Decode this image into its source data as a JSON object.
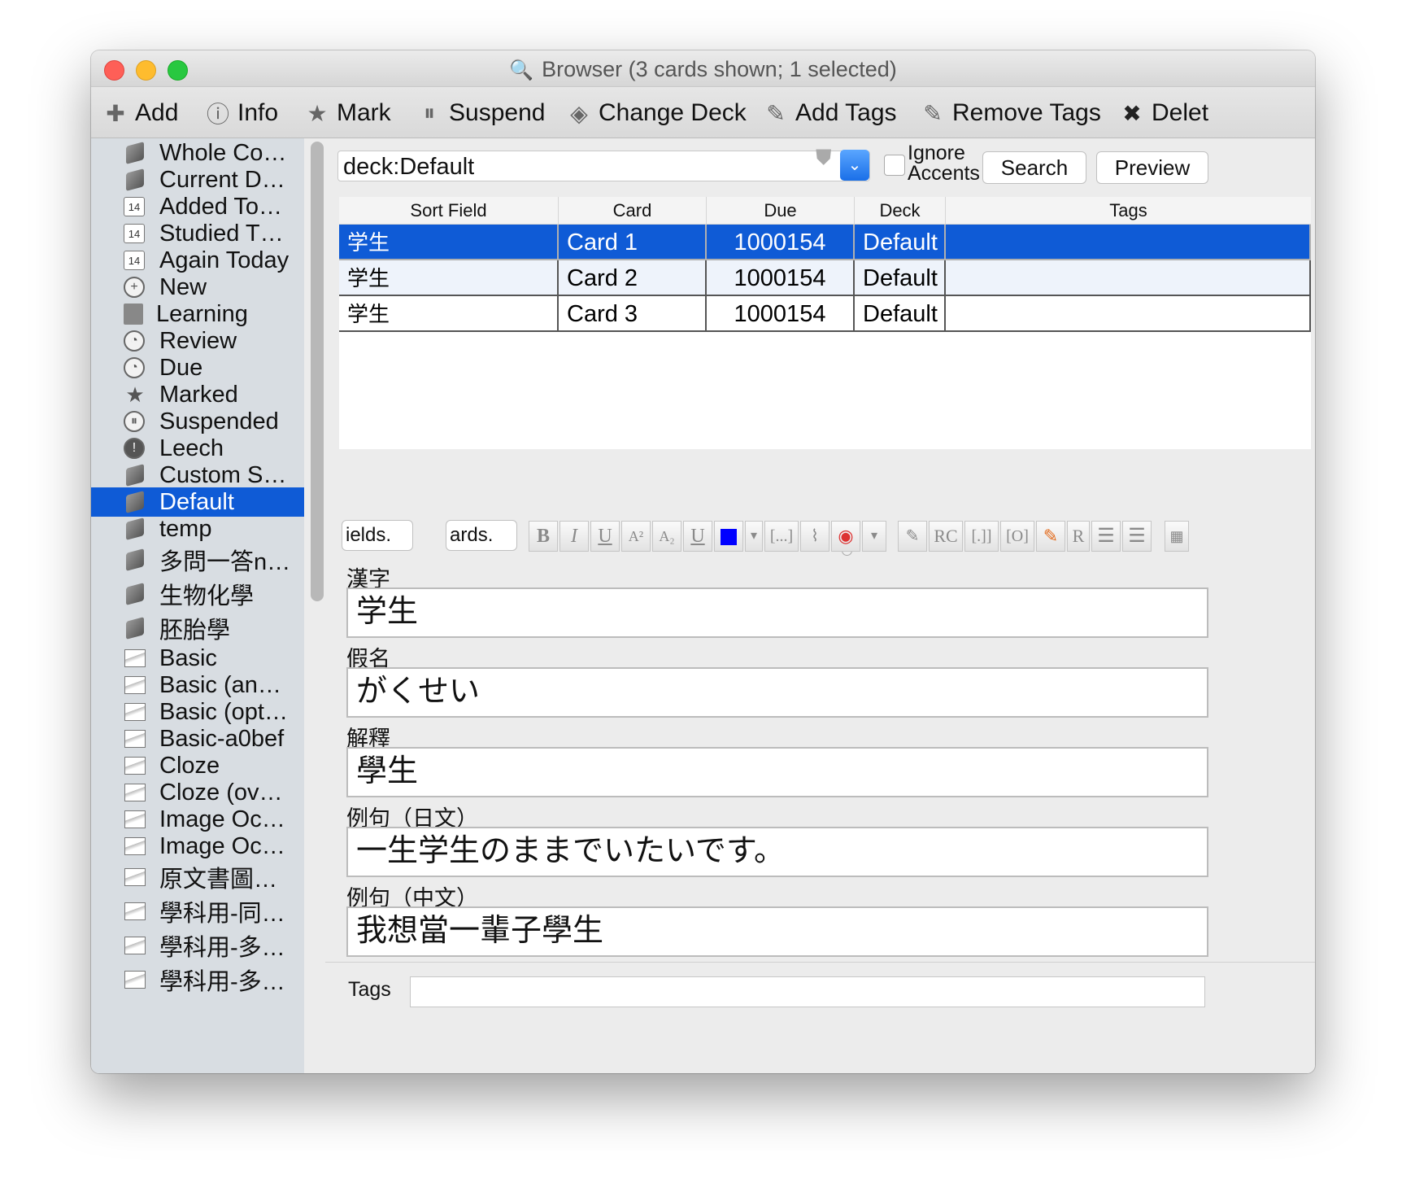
{
  "window": {
    "title": "Browser (3 cards shown; 1 selected)"
  },
  "toolbar": {
    "items": [
      {
        "label": "Add",
        "icon": "plus-icon"
      },
      {
        "label": "Info",
        "icon": "info-icon"
      },
      {
        "label": "Mark",
        "icon": "star-icon"
      },
      {
        "label": "Suspend",
        "icon": "pause-icon"
      },
      {
        "label": "Change Deck",
        "icon": "deck-icon"
      },
      {
        "label": "Add Tags",
        "icon": "tag-add-icon"
      },
      {
        "label": "Remove Tags",
        "icon": "tag-remove-icon"
      },
      {
        "label": "Delet",
        "icon": "delete-icon"
      }
    ]
  },
  "sidebar": {
    "items": [
      {
        "label": "Whole Co…",
        "icon": "collection-icon"
      },
      {
        "label": "Current D…",
        "icon": "deck-icon"
      },
      {
        "label": "Added To…",
        "icon": "calendar-icon"
      },
      {
        "label": "Studied T…",
        "icon": "calendar-icon"
      },
      {
        "label": "Again Today",
        "icon": "calendar-icon"
      },
      {
        "label": "New",
        "icon": "plus-circle-icon"
      },
      {
        "label": "Learning",
        "icon": "learning-icon"
      },
      {
        "label": "Review",
        "icon": "clock-icon"
      },
      {
        "label": "Due",
        "icon": "clock-icon"
      },
      {
        "label": "Marked",
        "icon": "star-icon"
      },
      {
        "label": "Suspended",
        "icon": "pause-icon"
      },
      {
        "label": "Leech",
        "icon": "exclamation-icon"
      },
      {
        "label": "Custom S…",
        "icon": "deck-icon"
      },
      {
        "label": "Default",
        "icon": "deck-icon",
        "selected": true
      },
      {
        "label": "temp",
        "icon": "deck-icon"
      },
      {
        "label": "多問一答n…",
        "icon": "deck-icon"
      },
      {
        "label": "生物化學",
        "icon": "deck-icon"
      },
      {
        "label": "胚胎學",
        "icon": "deck-icon"
      },
      {
        "label": "Basic",
        "icon": "note-type-icon"
      },
      {
        "label": "Basic (an…",
        "icon": "note-type-icon"
      },
      {
        "label": "Basic (opt…",
        "icon": "note-type-icon"
      },
      {
        "label": "Basic-a0bef",
        "icon": "note-type-icon"
      },
      {
        "label": "Cloze",
        "icon": "note-type-icon"
      },
      {
        "label": "Cloze (ov…",
        "icon": "note-type-icon"
      },
      {
        "label": "Image Oc…",
        "icon": "note-type-icon"
      },
      {
        "label": "Image Oc…",
        "icon": "note-type-icon"
      },
      {
        "label": "原文書圖…",
        "icon": "note-type-icon"
      },
      {
        "label": "學科用-同…",
        "icon": "note-type-icon"
      },
      {
        "label": "學科用-多…",
        "icon": "note-type-icon"
      },
      {
        "label": "學科用-多…",
        "icon": "note-type-icon"
      }
    ]
  },
  "search": {
    "value": "deck:Default",
    "ignore_accents_line1": "Ignore",
    "ignore_accents_line2": "Accents",
    "search_label": "Search",
    "preview_label": "Preview"
  },
  "table": {
    "columns": [
      "Sort Field",
      "Card",
      "Due",
      "Deck",
      "Tags"
    ],
    "rows": [
      {
        "sort_field": "学生",
        "card": "Card 1",
        "due": "1000154",
        "deck": "Default",
        "tags": "",
        "selected": true
      },
      {
        "sort_field": "学生",
        "card": "Card 2",
        "due": "1000154",
        "deck": "Default",
        "tags": ""
      },
      {
        "sort_field": "学生",
        "card": "Card 3",
        "due": "1000154",
        "deck": "Default",
        "tags": ""
      }
    ]
  },
  "editor": {
    "fields_button": "ields.",
    "cards_button": "ards.",
    "format_buttons": [
      "B",
      "I",
      "U",
      "A²",
      "A₂",
      "U",
      "",
      "▾",
      "[...]",
      "📎",
      "●",
      "▾",
      "✎",
      "RC",
      "[.]]",
      "[O]",
      "✎",
      "R",
      "≡",
      "≡"
    ],
    "text_color": "#0000ff",
    "fields": [
      {
        "label": "漢字",
        "value": "学生"
      },
      {
        "label": "假名",
        "value": "がくせい"
      },
      {
        "label": "解釋",
        "value": "學生"
      },
      {
        "label": "例句（日文）",
        "value": "一生学生のままでいたいです。"
      },
      {
        "label": "例句（中文）",
        "value": "我想當一輩子學生"
      }
    ],
    "tags_label": "Tags",
    "tags_value": ""
  },
  "colors": {
    "selection": "#0f5bd6",
    "sidebar_bg": "#d8dde2"
  }
}
